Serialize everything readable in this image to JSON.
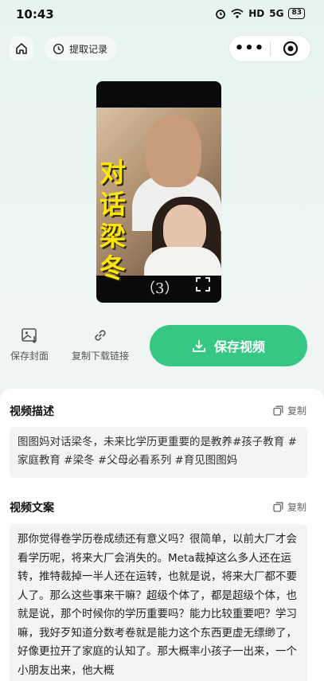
{
  "status_bar": {
    "time": "10:43",
    "alarm_icon": "alarm-icon",
    "wifi_icon": "wifi-icon",
    "hd_label": "HD",
    "signal_label": "5G",
    "battery": "83"
  },
  "nav": {
    "home_icon": "home-icon",
    "history_label": "提取记录",
    "more_label": "•••",
    "close_icon": "target-icon"
  },
  "video": {
    "overlay_title": "对话梁冬",
    "episode": "（3）"
  },
  "actions": {
    "save_cover": "保存封面",
    "copy_link": "复制下载链接",
    "save_video": "保存视频"
  },
  "description": {
    "title": "视频描述",
    "copy_label": "复制",
    "text": "图图妈对话梁冬，未来比学历更重要的是教养#孩子教育 #家庭教育 #梁冬 #父母必看系列 #育见图图妈"
  },
  "transcript": {
    "title": "视频文案",
    "copy_label": "复制",
    "text": "那你觉得卷学历卷成绩还有意义吗？很简单，以前大厂才会看学历呢，将来大厂会消失的。Meta裁掉这么多人还在运转，推特裁掉一半人还在运转，也就是说，将来大厂都不要人了。那么这些事来干嘛？超级个体了，都是超级个体，也就是说，那个时候你的学历重要吗？能力比较重要吧？学习嘛，我好歹知道分数考卷就是能力这个东西更虚无缥缈了，好像更拉开了家庭的认知了。那大概率小孩子一出来，一个小朋友出来，他大概"
  },
  "colors": {
    "accent": "#36c784",
    "title_yellow": "#ffe600"
  }
}
